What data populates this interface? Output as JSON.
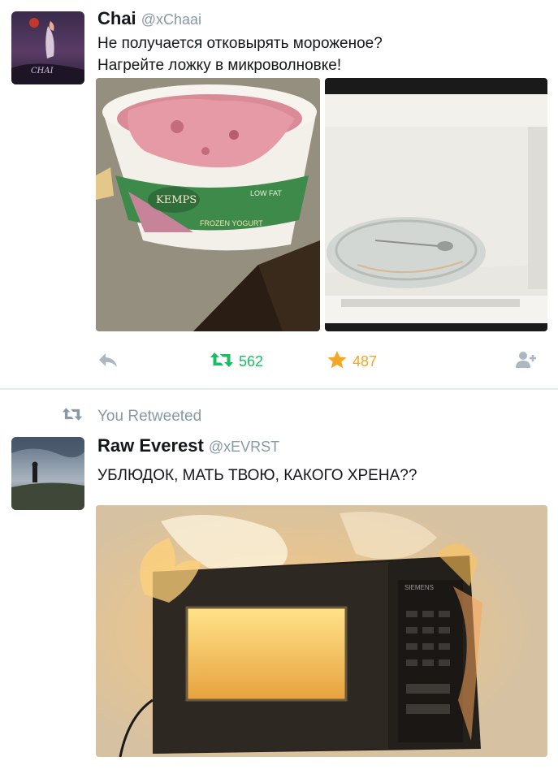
{
  "tweet1": {
    "display_name": "Chai",
    "handle": "@xChaai",
    "avatar_caption": "CHAI",
    "text": "Не получается отковырять мороженое?\nНагрейте ложку в микроволновке!",
    "photo_left_brand": "KEMPS",
    "photo_left_product": "FROZEN YOGURT",
    "photo_left_tag": "LOW FAT",
    "retweet_count": "562",
    "favorite_count": "487",
    "icons": [
      "reply-icon",
      "retweet-icon",
      "star-icon",
      "follow-icon"
    ],
    "colors": {
      "retweet": "#17bf63",
      "favorite": "#f5a623",
      "muted": "#aab8c2"
    }
  },
  "tweet2": {
    "retweet_banner": "You Retweeted",
    "display_name": "Raw Everest",
    "handle": "@xEVRST",
    "text": "УБЛЮДОК, МАТЬ ТВОЮ, КАКОГО ХРЕНА??",
    "photo_brand": "SIEMENS"
  }
}
